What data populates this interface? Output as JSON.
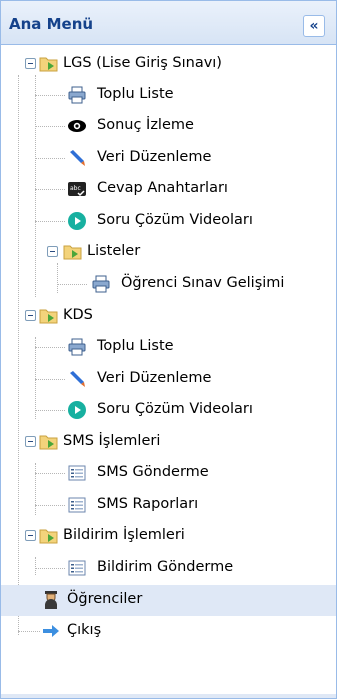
{
  "panel": {
    "title": "Ana Menü",
    "collapse_icon": "double-chevron-left-icon"
  },
  "menu": {
    "lgs": "LGS (Lise Giriş Sınavı)",
    "lgs_toplu": "Toplu Liste",
    "lgs_sonuc": "Sonuç İzleme",
    "lgs_veri": "Veri Düzenleme",
    "lgs_cevap": "Cevap Anahtarları",
    "lgs_video": "Soru Çözüm Videoları",
    "listeler": "Listeler",
    "ogrenci_sinav": "Öğrenci Sınav Gelişimi",
    "kds": "KDS",
    "kds_toplu": "Toplu Liste",
    "kds_veri": "Veri Düzenleme",
    "kds_video": "Soru Çözüm Videoları",
    "sms": "SMS İşlemleri",
    "sms_gonderme": "SMS Gönderme",
    "sms_rapor": "SMS Raporları",
    "bildirim": "Bildirim İşlemleri",
    "bildirim_gonderme": "Bildirim Gönderme",
    "ogrenciler": "Öğrenciler",
    "cikis": "Çıkış"
  }
}
